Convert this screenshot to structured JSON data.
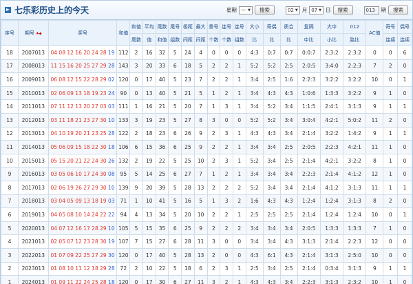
{
  "header": {
    "title": "七乐彩历史上的今天",
    "weekday_label": "星期",
    "weekday_value": "一",
    "search_label": "搜索",
    "month_value": "02",
    "month_label": "月",
    "day_value": "07",
    "day_label": "日",
    "issue_value": "013",
    "issue_label": "期"
  },
  "columns": {
    "seq": "序号",
    "period": "期号",
    "sort": "排序",
    "numbers": "奖号",
    "sum": "和值",
    "sumtail_a": "和值",
    "sumtail_b": "尾数",
    "avg_a": "平均",
    "avg_b": "值",
    "tailsum_a": "尾数",
    "tailsum_b": "和值",
    "tailgroup_a": "尾号",
    "tailgroup_b": "组数",
    "span_a": "极距",
    "span_b": "间距",
    "maxgap_a": "最大",
    "maxgap_b": "间距",
    "repeat_a": "重号",
    "repeat_b": "个数",
    "consec_a": "连号",
    "consec_b": "个数",
    "consecgroup_a": "连号",
    "consecgroup_b": "组数",
    "size_a": "大小",
    "size_b": "比",
    "oddeven_a": "奇偶",
    "oddeven_b": "比",
    "primecomp_a": "质合",
    "primecomp_b": "比",
    "repeatgap_a": "复隔",
    "repeatgap_b": "中比",
    "bigmid_a": "大中",
    "bigmid_b": "小比",
    "road_a": "012",
    "road_b": "路比",
    "ac": "AC值",
    "oddconsec_a": "奇号",
    "oddconsec_b": "连续",
    "evenconsec_a": "偶号",
    "evenconsec_b": "连续"
  },
  "rows": [
    {
      "seq": "18",
      "period": "2007013",
      "nums": [
        "04",
        "08",
        "12",
        "16",
        "20",
        "24",
        "28"
      ],
      "sp": "19",
      "sum": "112",
      "sumtail": "2",
      "avg": "16",
      "tailsum": "32",
      "tg": "5",
      "span": "24",
      "gap": "4",
      "rep": "0",
      "con": "0",
      "cong": "0",
      "size": "4:3",
      "oe": "0:7",
      "pc": "0:7",
      "rg": "0:0:7",
      "bm": "2:3:2",
      "road": "2:3:2",
      "ac": "0",
      "oc": "0",
      "ec": "6"
    },
    {
      "seq": "17",
      "period": "2008013",
      "nums": [
        "11",
        "15",
        "16",
        "20",
        "25",
        "27",
        "29"
      ],
      "sp": "28",
      "sum": "143",
      "sumtail": "3",
      "avg": "20",
      "tailsum": "33",
      "tg": "6",
      "span": "18",
      "gap": "5",
      "rep": "2",
      "con": "2",
      "cong": "1",
      "size": "5:2",
      "oe": "5:2",
      "pc": "2:5",
      "rg": "2:0:5",
      "bm": "3:4:0",
      "road": "2:2:3",
      "ac": "7",
      "oc": "2",
      "ec": "0"
    },
    {
      "seq": "16",
      "period": "2009013",
      "nums": [
        "06",
        "08",
        "12",
        "15",
        "22",
        "28",
        "29"
      ],
      "sp": "02",
      "sum": "120",
      "sumtail": "0",
      "avg": "17",
      "tailsum": "40",
      "tg": "5",
      "span": "23",
      "gap": "7",
      "rep": "2",
      "con": "2",
      "cong": "1",
      "size": "3:4",
      "oe": "2:5",
      "pc": "1:6",
      "rg": "2:2:3",
      "bm": "3:2:2",
      "road": "3:2:2",
      "ac": "10",
      "oc": "0",
      "ec": "1"
    },
    {
      "seq": "15",
      "period": "2010013",
      "nums": [
        "02",
        "06",
        "09",
        "13",
        "18",
        "19",
        "23"
      ],
      "sp": "24",
      "sum": "90",
      "sumtail": "0",
      "avg": "13",
      "tailsum": "40",
      "tg": "5",
      "span": "21",
      "gap": "5",
      "rep": "1",
      "con": "2",
      "cong": "1",
      "size": "3:4",
      "oe": "4:3",
      "pc": "4:3",
      "rg": "1:0:6",
      "bm": "1:3:3",
      "road": "3:2:2",
      "ac": "9",
      "oc": "1",
      "ec": "0"
    },
    {
      "seq": "14",
      "period": "2011013",
      "nums": [
        "07",
        "11",
        "12",
        "13",
        "20",
        "27",
        "03"
      ],
      "sp": "03",
      "sum": "111",
      "sumtail": "1",
      "avg": "16",
      "tailsum": "21",
      "tg": "5",
      "span": "20",
      "gap": "7",
      "rep": "1",
      "con": "3",
      "cong": "1",
      "size": "3:4",
      "oe": "5:2",
      "pc": "3:4",
      "rg": "1:1:5",
      "bm": "2:4:1",
      "road": "3:1:3",
      "ac": "9",
      "oc": "1",
      "ec": "1"
    },
    {
      "seq": "13",
      "period": "2012013",
      "nums": [
        "03",
        "11",
        "18",
        "21",
        "23",
        "27",
        "30"
      ],
      "sp": "10",
      "sum": "133",
      "sumtail": "3",
      "avg": "19",
      "tailsum": "23",
      "tg": "5",
      "span": "27",
      "gap": "8",
      "rep": "3",
      "con": "0",
      "cong": "0",
      "size": "5:2",
      "oe": "5:2",
      "pc": "3:4",
      "rg": "3:0:4",
      "bm": "4:2:1",
      "road": "5:0:2",
      "ac": "11",
      "oc": "2",
      "ec": "0"
    },
    {
      "seq": "12",
      "period": "2013013",
      "nums": [
        "04",
        "10",
        "19",
        "20",
        "21",
        "23",
        "25"
      ],
      "sp": "28",
      "sum": "122",
      "sumtail": "2",
      "avg": "18",
      "tailsum": "23",
      "tg": "6",
      "span": "26",
      "gap": "9",
      "rep": "2",
      "con": "3",
      "cong": "1",
      "size": "4:3",
      "oe": "4:3",
      "pc": "3:4",
      "rg": "2:1:4",
      "bm": "3:2:2",
      "road": "1:4:2",
      "ac": "9",
      "oc": "1",
      "ec": "1"
    },
    {
      "seq": "11",
      "period": "2014013",
      "nums": [
        "05",
        "06",
        "09",
        "15",
        "18",
        "22",
        "30"
      ],
      "sp": "18",
      "sum": "106",
      "sumtail": "6",
      "avg": "15",
      "tailsum": "36",
      "tg": "6",
      "span": "25",
      "gap": "9",
      "rep": "2",
      "con": "2",
      "cong": "1",
      "size": "3:4",
      "oe": "3:4",
      "pc": "2:5",
      "rg": "2:0:5",
      "bm": "2:2:3",
      "road": "4:2:1",
      "ac": "11",
      "oc": "1",
      "ec": "0"
    },
    {
      "seq": "10",
      "period": "2015013",
      "nums": [
        "05",
        "15",
        "20",
        "21",
        "22",
        "24",
        "30"
      ],
      "sp": "26",
      "sum": "132",
      "sumtail": "2",
      "avg": "19",
      "tailsum": "22",
      "tg": "5",
      "span": "25",
      "gap": "10",
      "rep": "2",
      "con": "3",
      "cong": "1",
      "size": "5:2",
      "oe": "3:4",
      "pc": "2:5",
      "rg": "2:1:4",
      "bm": "4:2:1",
      "road": "3:2:2",
      "ac": "8",
      "oc": "1",
      "ec": "0"
    },
    {
      "seq": "9",
      "period": "2016013",
      "nums": [
        "03",
        "05",
        "06",
        "10",
        "17",
        "24",
        "30"
      ],
      "sp": "08",
      "sum": "95",
      "sumtail": "5",
      "avg": "14",
      "tailsum": "25",
      "tg": "6",
      "span": "27",
      "gap": "7",
      "rep": "1",
      "con": "2",
      "cong": "1",
      "size": "3:4",
      "oe": "3:4",
      "pc": "3:4",
      "rg": "2:2:3",
      "bm": "2:1:4",
      "road": "4:1:2",
      "ac": "12",
      "oc": "1",
      "ec": "0"
    },
    {
      "seq": "8",
      "period": "2017013",
      "nums": [
        "02",
        "06",
        "19",
        "26",
        "27",
        "29",
        "30"
      ],
      "sp": "10",
      "sum": "139",
      "sumtail": "9",
      "avg": "20",
      "tailsum": "39",
      "tg": "5",
      "span": "28",
      "gap": "13",
      "rep": "2",
      "con": "2",
      "cong": "2",
      "size": "5:2",
      "oe": "3:4",
      "pc": "3:4",
      "rg": "2:1:4",
      "bm": "4:1:2",
      "road": "3:1:3",
      "ac": "11",
      "oc": "1",
      "ec": "1"
    },
    {
      "seq": "7",
      "period": "2018013",
      "nums": [
        "03",
        "04",
        "05",
        "09",
        "13",
        "18",
        "19"
      ],
      "sp": "03",
      "sum": "71",
      "sumtail": "1",
      "avg": "10",
      "tailsum": "41",
      "tg": "5",
      "span": "16",
      "gap": "5",
      "rep": "1",
      "con": "3",
      "cong": "2",
      "size": "1:6",
      "oe": "4:3",
      "pc": "4:3",
      "rg": "1:2:4",
      "bm": "1:2:4",
      "road": "3:1:3",
      "ac": "8",
      "oc": "2",
      "ec": "0"
    },
    {
      "seq": "6",
      "period": "2019013",
      "nums": [
        "04",
        "05",
        "08",
        "10",
        "14",
        "24",
        "22"
      ],
      "sp": "22",
      "sum": "94",
      "sumtail": "4",
      "avg": "13",
      "tailsum": "34",
      "tg": "5",
      "span": "20",
      "gap": "10",
      "rep": "2",
      "con": "2",
      "cong": "1",
      "size": "2:5",
      "oe": "2:5",
      "pc": "2:5",
      "rg": "2:1:4",
      "bm": "1:2:4",
      "road": "1:2:4",
      "ac": "10",
      "oc": "0",
      "ec": "1"
    },
    {
      "seq": "5",
      "period": "2020013",
      "nums": [
        "04",
        "07",
        "12",
        "16",
        "17",
        "28",
        "29"
      ],
      "sp": "10",
      "sum": "105",
      "sumtail": "5",
      "avg": "15",
      "tailsum": "35",
      "tg": "6",
      "span": "25",
      "gap": "9",
      "rep": "2",
      "con": "2",
      "cong": "2",
      "size": "3:4",
      "oe": "3:4",
      "pc": "3:4",
      "rg": "2:0:5",
      "bm": "1:3:3",
      "road": "1:3:3",
      "ac": "7",
      "oc": "1",
      "ec": "0"
    },
    {
      "seq": "4",
      "period": "2021013",
      "nums": [
        "02",
        "05",
        "07",
        "12",
        "23",
        "28",
        "30"
      ],
      "sp": "19",
      "sum": "107",
      "sumtail": "7",
      "avg": "15",
      "tailsum": "27",
      "tg": "6",
      "span": "28",
      "gap": "11",
      "rep": "3",
      "con": "0",
      "cong": "0",
      "size": "3:4",
      "oe": "3:4",
      "pc": "4:3",
      "rg": "3:1:3",
      "bm": "2:1:4",
      "road": "2:2:3",
      "ac": "12",
      "oc": "0",
      "ec": "0"
    },
    {
      "seq": "3",
      "period": "2022013",
      "nums": [
        "01",
        "07",
        "09",
        "22",
        "25",
        "27",
        "29"
      ],
      "sp": "30",
      "sum": "120",
      "sumtail": "0",
      "avg": "17",
      "tailsum": "40",
      "tg": "5",
      "span": "28",
      "gap": "13",
      "rep": "2",
      "con": "0",
      "cong": "0",
      "size": "4:3",
      "oe": "6:1",
      "pc": "4:3",
      "rg": "2:1:4",
      "bm": "3:1:3",
      "road": "2:5:0",
      "ac": "10",
      "oc": "0",
      "ec": "0"
    },
    {
      "seq": "2",
      "period": "2023013",
      "nums": [
        "01",
        "08",
        "10",
        "11",
        "12",
        "18",
        "29"
      ],
      "sp": "28",
      "sum": "72",
      "sumtail": "2",
      "avg": "10",
      "tailsum": "22",
      "tg": "5",
      "span": "18",
      "gap": "6",
      "rep": "2",
      "con": "3",
      "cong": "1",
      "size": "2:5",
      "oe": "3:4",
      "pc": "2:5",
      "rg": "2:1:4",
      "bm": "0:3:4",
      "road": "3:1:3",
      "ac": "9",
      "oc": "1",
      "ec": "1"
    },
    {
      "seq": "1",
      "period": "2024013",
      "nums": [
        "01",
        "09",
        "11",
        "22",
        "24",
        "25",
        "28"
      ],
      "sp": "18",
      "sum": "120",
      "sumtail": "0",
      "avg": "17",
      "tailsum": "30",
      "tg": "6",
      "span": "27",
      "gap": "11",
      "rep": "3",
      "con": "2",
      "cong": "1",
      "size": "4:3",
      "oe": "4:3",
      "pc": "3:4",
      "rg": "2:2:3",
      "bm": "3:1:3",
      "road": "2:3:2",
      "ac": "10",
      "oc": "1",
      "ec": "0"
    }
  ],
  "colors": {
    "red_numbers": "#e0352b",
    "special_number": "#2f5fd6",
    "header_bg": "#eaf2fb"
  }
}
